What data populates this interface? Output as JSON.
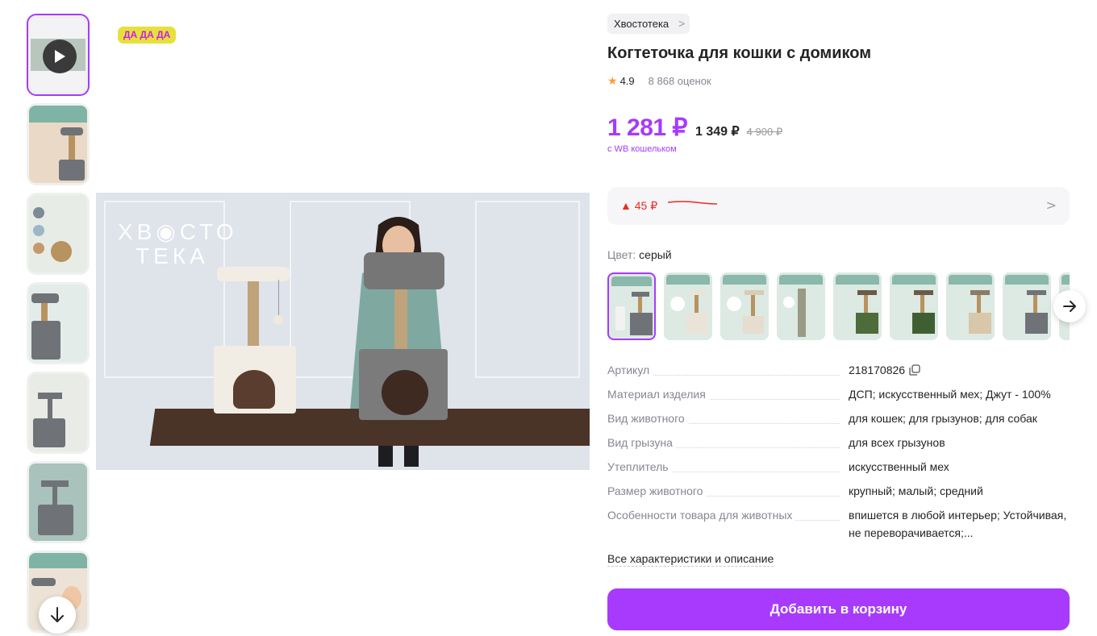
{
  "promo_badge": "ДА ДА ДА",
  "gallery": {
    "main_image_alt": "видео превью",
    "brand_watermark_line1": "ХВ◉СТО",
    "brand_watermark_line2": "ТЕКА"
  },
  "product": {
    "brand": "Хвостотека",
    "title": "Когтеточка для кошки с домиком",
    "rating": "4.9",
    "reviews": "8 868 оценок",
    "price_main": "1 281 ₽",
    "price_mid": "1 349 ₽",
    "price_old": "4 900 ₽",
    "wallet_note": "с WB кошельком",
    "price_change": "▲ 45 ₽"
  },
  "color": {
    "label": "Цвет:",
    "value": "серый"
  },
  "specs": [
    {
      "key": "Артикул",
      "value": "218170826"
    },
    {
      "key": "Материал изделия",
      "value": "ДСП; искусственный мех; Джут - 100%"
    },
    {
      "key": "Вид животного",
      "value": "для кошек; для грызунов; для собак"
    },
    {
      "key": "Вид грызуна",
      "value": "для всех грызунов"
    },
    {
      "key": "Утеплитель",
      "value": "искусственный мех"
    },
    {
      "key": "Размер животного",
      "value": "крупный; малый; средний"
    },
    {
      "key": "Особенности товара для животных",
      "value": "впишется в любой интерьер; Устойчивая, не переворачивается;..."
    }
  ],
  "all_specs_link": "Все характеристики и описание",
  "add_to_cart": "Добавить в корзину",
  "colors_accent": {
    "brand_purple": "#a73afd",
    "promo_yellow": "#e6e13a",
    "promo_text": "#cc1ee3",
    "price_up_red": "#f0291d",
    "star_orange": "#ff9b3d"
  },
  "icons": [
    "play-icon",
    "arrow-down-icon",
    "chevron-right-icon",
    "star-icon",
    "copy-icon",
    "arrow-right-icon"
  ]
}
